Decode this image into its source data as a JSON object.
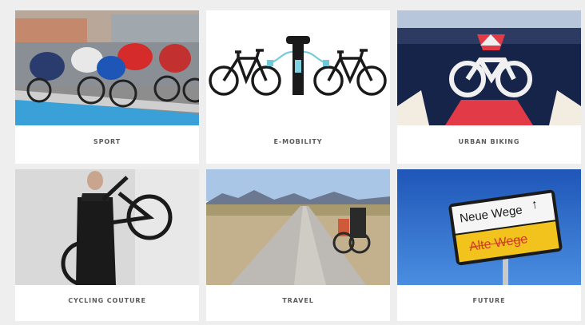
{
  "tiles": [
    {
      "label": "SPORT",
      "image": "road-cycling-race-photo"
    },
    {
      "label": "E-MOBILITY",
      "image": "e-bike-charging-illustration"
    },
    {
      "label": "URBAN BIKING",
      "image": "bike-lane-symbol-photo"
    },
    {
      "label": "CYCLING COUTURE",
      "image": "man-carrying-bicycle-photo"
    },
    {
      "label": "TRAVEL",
      "image": "desert-road-touring-bike-photo"
    },
    {
      "label": "FUTURE",
      "image": "road-sign-photo",
      "sign_top": "Neue Wege",
      "sign_bottom": "Alte Wege"
    }
  ]
}
